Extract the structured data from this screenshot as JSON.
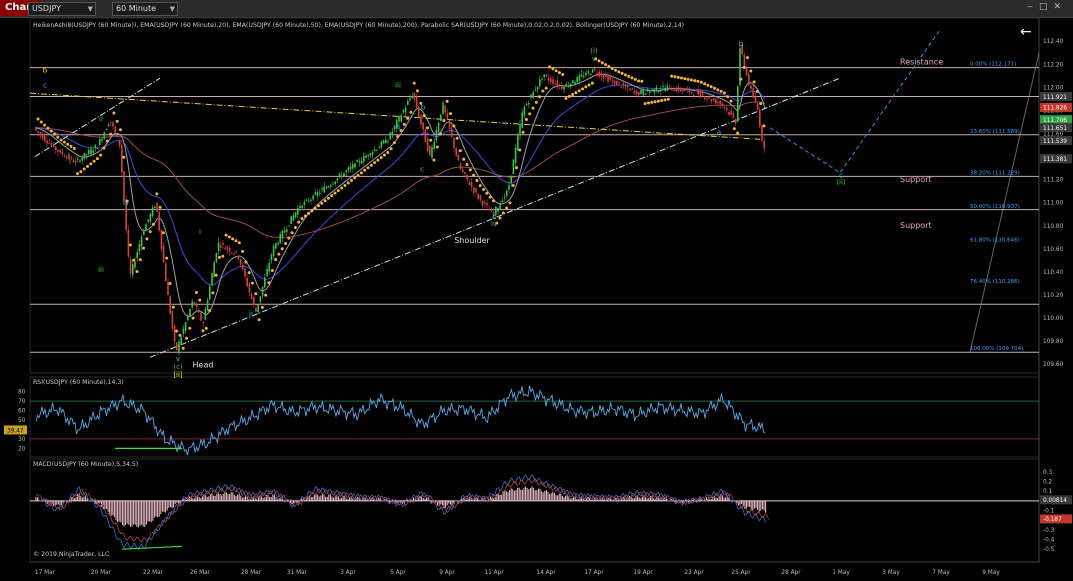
{
  "window": {
    "tab": "Chart",
    "symbol": "USDJPY",
    "timeframe": "60 Minute",
    "copyright": "© 2019 NinjaTrader, LLC",
    "back_arrow": "←"
  },
  "panels": {
    "price_title": "HeikenAshi8(USDJPY (60 Minute)), EMA(USDJPY (60 Minute),20), EMA(USDJPY (60 Minute),50), EMA(USDJPY (60 Minute),200), Parabolic SAR(USDJPY (60 Minute),0.02,0.2,0.02), Bollinger(USDJPY (60 Minute),2,14)",
    "rsi_title": "RSI(USDJPY (60 Minute),14,3)",
    "macd_title": "MACD(USDJPY (60 Minute),5,34,5)"
  },
  "colors": {
    "background": "#000000",
    "bull": "#3ec24a",
    "bear": "#d24444",
    "sar": "#f2b33d",
    "ema20": "#a0a0a0",
    "ema50": "#3a4bd4",
    "ema200": "#9a4a4a",
    "rsi": "#5aa6e6",
    "macd_hist": "#f7c9d2",
    "level_line": "#ecc8cf",
    "fib_label": "#3aa3ff",
    "wave_label_cyan": "#28c8d8",
    "wave_label_green": "#2fd13a",
    "wave_label_yellow": "#e7e73a"
  },
  "chart_data": [
    {
      "type": "candlestick",
      "panel": "price",
      "x_ticks": [
        "17 Mar",
        "20 Mar",
        "22 Mar",
        "26 Mar",
        "28 Mar",
        "31 Mar",
        "3 Apr",
        "5 Apr",
        "9 Apr",
        "11 Apr",
        "14 Apr",
        "17 Apr",
        "19 Apr",
        "23 Apr",
        "25 Apr",
        "28 Apr",
        "1 May",
        "3 May",
        "7 May",
        "9 May"
      ],
      "y_ticks": [
        "112.40",
        "112.20",
        "112.00",
        "111.80",
        "111.60",
        "111.40",
        "111.20",
        "111.00",
        "110.80",
        "110.60",
        "110.40",
        "110.20",
        "110.00",
        "109.80",
        "109.60"
      ],
      "ylim": [
        109.55,
        112.48
      ],
      "price_markers": [
        {
          "label": "111.921",
          "value": 111.921,
          "color": "#3a3a3a"
        },
        {
          "label": "111.826",
          "value": 111.826,
          "color": "#c0392b"
        },
        {
          "label": "111.706",
          "value": 111.72,
          "color": "#2ea043"
        },
        {
          "label": "111.651",
          "value": 111.651,
          "color": "#3a3a3a"
        },
        {
          "label": "111.539",
          "value": 111.539,
          "color": "#3a3a3a"
        },
        {
          "label": "111.381",
          "value": 111.381,
          "color": "#3a3a3a"
        }
      ],
      "horizontal_levels": [
        112.171,
        111.921,
        111.589,
        111.229,
        110.94,
        110.12,
        109.704
      ],
      "level_labels": [
        {
          "text": "Resistance",
          "value": 112.2
        },
        {
          "text": "Support",
          "value": 111.18
        },
        {
          "text": "Support",
          "value": 110.78
        }
      ],
      "fibonacci": [
        {
          "label": "0.00% (112.171)",
          "value": 112.171
        },
        {
          "label": "23.60% (111.589)",
          "value": 111.589
        },
        {
          "label": "38.20% (111.229)",
          "value": 111.229
        },
        {
          "label": "50.00% (110.937)",
          "value": 110.937
        },
        {
          "label": "61.80% (110.646)",
          "value": 110.646
        },
        {
          "label": "76.40% (110.286)",
          "value": 110.286
        },
        {
          "label": "100.00% (109.704)",
          "value": 109.704
        }
      ],
      "wave_labels": [
        {
          "text": "c",
          "date": "17 Mar",
          "price": 112.0,
          "color": "cyan"
        },
        {
          "text": "b",
          "date": "17 Mar",
          "price": 112.13,
          "color": "yellow"
        },
        {
          "text": "i",
          "date": "18 Mar",
          "price": 111.33,
          "color": "green"
        },
        {
          "text": "ii",
          "date": "20 Mar",
          "price": 111.71,
          "color": "green"
        },
        {
          "text": "iii",
          "date": "20 Mar",
          "price": 110.4,
          "color": "green"
        },
        {
          "text": "iv",
          "date": "21 Mar",
          "price": 110.98,
          "color": "cyan"
        },
        {
          "text": "v",
          "date": "23 Mar",
          "price": 109.63,
          "color": "cyan"
        },
        {
          "text": "(c)",
          "date": "23 Mar",
          "price": 109.56,
          "color": "green"
        },
        {
          "text": "[ii]",
          "date": "23 Mar",
          "price": 109.49,
          "color": "yellow"
        },
        {
          "text": "i",
          "date": "26 Mar",
          "price": 110.73,
          "color": "cyan"
        },
        {
          "text": "ii",
          "date": "28 Mar",
          "price": 110.02,
          "color": "cyan"
        },
        {
          "text": "iii",
          "date": "5 Apr",
          "price": 112.0,
          "color": "green"
        },
        {
          "text": "a",
          "date": "5 Apr",
          "price": 111.64,
          "color": "cyan"
        },
        {
          "text": "b",
          "date": "6 Apr",
          "price": 111.81,
          "color": "cyan"
        },
        {
          "text": "c",
          "date": "8 Apr",
          "price": 111.27,
          "color": "cyan"
        },
        {
          "text": "c",
          "date": "11 Apr",
          "price": 110.86,
          "color": "cyan"
        },
        {
          "text": "iv",
          "date": "11 Apr",
          "price": 110.8,
          "color": "green"
        },
        {
          "text": "(i)",
          "date": "17 Apr",
          "price": 112.3,
          "color": "green"
        },
        {
          "text": "v",
          "date": "17 Apr",
          "price": 112.23,
          "color": "green"
        },
        {
          "text": "b",
          "date": "25 Apr",
          "price": 112.36,
          "color": "cyan"
        },
        {
          "text": "a",
          "date": "24 Apr",
          "price": 111.59,
          "color": "cyan"
        },
        {
          "text": "c",
          "date": "1 May",
          "price": 111.22,
          "color": "cyan"
        },
        {
          "text": "(ii)",
          "date": "1 May",
          "price": 111.16,
          "color": "green"
        }
      ],
      "pattern_labels": [
        {
          "text": "Head",
          "date": "24 Mar",
          "price": 109.57
        },
        {
          "text": "Shoulder",
          "date": "10 Apr",
          "price": 110.65
        }
      ]
    },
    {
      "type": "line",
      "panel": "rsi",
      "series": [
        {
          "name": "RSI",
          "values": [
            55,
            62,
            40,
            58,
            70,
            60,
            30,
            18,
            26,
            42,
            52,
            66,
            58,
            64,
            60,
            56,
            72,
            63,
            45,
            60,
            62,
            52,
            75,
            80,
            70,
            60,
            58,
            62,
            55,
            64,
            60,
            57,
            72,
            46,
            40
          ]
        }
      ],
      "y_ticks": [
        "80",
        "70",
        "60",
        "50",
        "40",
        "30",
        "20"
      ],
      "ylim": [
        13,
        87
      ],
      "current_value": "39.47",
      "reference_lines": [
        70,
        30
      ]
    },
    {
      "type": "bar",
      "panel": "macd",
      "series": [
        {
          "name": "MACD",
          "values": [
            0.05,
            -0.1,
            0.12,
            -0.08,
            -0.45,
            -0.48,
            -0.2,
            0.05,
            0.1,
            0.15,
            0.05,
            0.1,
            -0.05,
            0.12,
            0.08,
            0.04,
            0.03,
            -0.04,
            0.08,
            -0.12,
            0.05,
            0.02,
            0.2,
            0.25,
            0.15,
            0.06,
            0.04,
            0.03,
            0.08,
            0.06,
            -0.02,
            0.02,
            0.1,
            -0.12,
            -0.2
          ]
        }
      ],
      "y_ticks": [
        "0.3",
        "0.2",
        "0.1",
        "-0.1",
        "-0.2",
        "-0.3",
        "-0.4",
        "-0.5"
      ],
      "ylim": [
        -0.56,
        0.36
      ],
      "value_markers": [
        {
          "label": "0.00814",
          "color": "#3a3a3a"
        },
        {
          "label": "-0.187",
          "color": "#c0392b"
        }
      ]
    }
  ]
}
